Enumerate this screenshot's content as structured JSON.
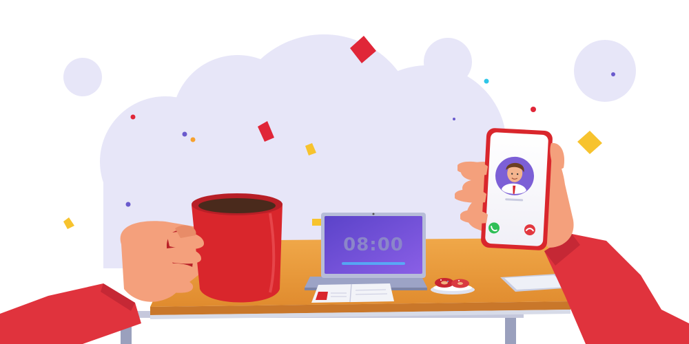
{
  "laptop": {
    "screen_time": "08:00"
  },
  "phone": {
    "state": "incoming-call",
    "accept_icon": "phone-accept-icon",
    "decline_icon": "phone-decline-icon"
  },
  "colors": {
    "background_cloud": "#e7e6f8",
    "table_top": "#e89a3c",
    "mug": "#d9262c",
    "sleeve": "#e0333d",
    "skin": "#f4a07c",
    "laptop_screen": "#6c4bd6",
    "accept_green": "#2fbf57",
    "decline_red": "#e2373f"
  }
}
